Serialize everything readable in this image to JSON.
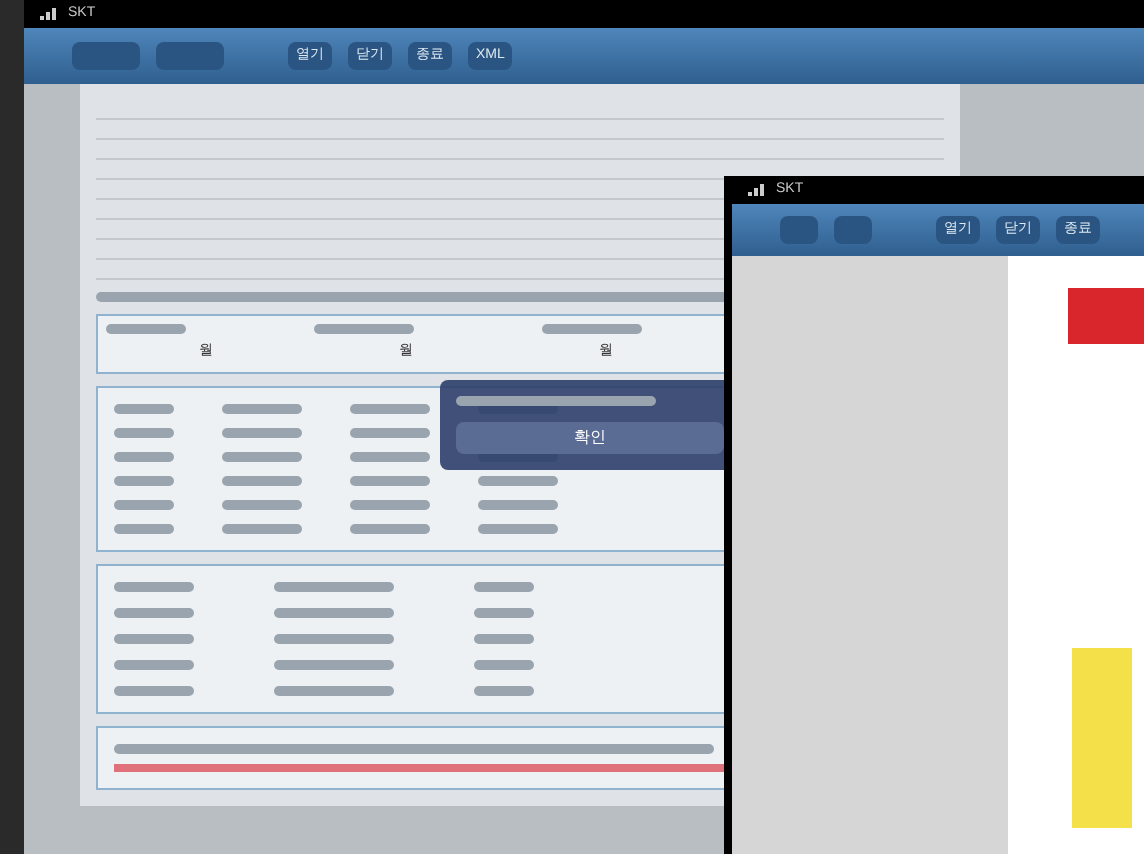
{
  "main_screen": {
    "status_bar": {
      "carrier": "SKT"
    },
    "toolbar": {
      "buttons": [
        {
          "label": "열기"
        },
        {
          "label": "닫기"
        },
        {
          "label": "종료"
        },
        {
          "label": "XML"
        }
      ]
    },
    "form": {
      "totals": [
        "월",
        "월",
        "월"
      ]
    },
    "dialog": {
      "button": "확인"
    }
  },
  "second_screen": {
    "status_bar": {
      "carrier": "SKT"
    },
    "toolbar": {
      "buttons": [
        {
          "label": "열기"
        },
        {
          "label": "닫기"
        },
        {
          "label": "종료"
        }
      ]
    }
  }
}
